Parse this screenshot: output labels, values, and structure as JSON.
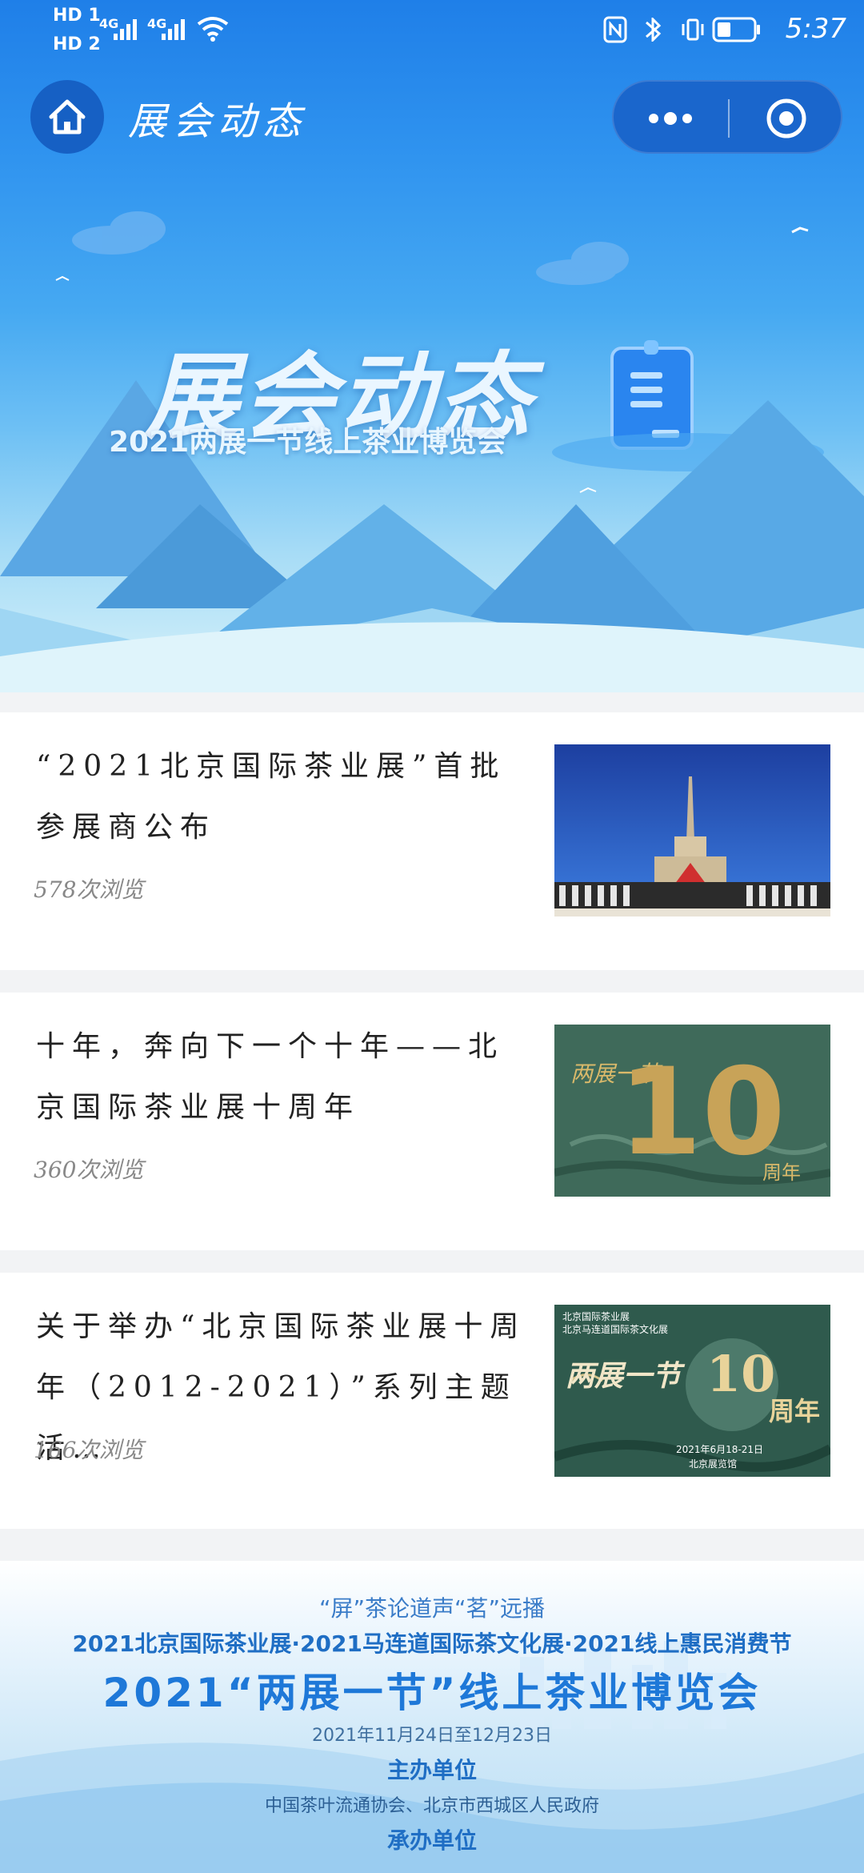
{
  "status_bar": {
    "sim1": "HD 1",
    "sim2": "HD 2",
    "net1": "4G",
    "net2": "4G",
    "time": "5:37"
  },
  "nav": {
    "title": "展会动态"
  },
  "banner": {
    "title": "展会动态",
    "subtitle": "2021两展一节线上茶业博览会"
  },
  "articles": [
    {
      "title": "“2021北京国际茶业展”首批参展商公布",
      "views": "578次浏览"
    },
    {
      "title": "十年，奔向下一个十年——北京国际茶业展十周年",
      "views": "360次浏览",
      "thumb_text": {
        "top": "两展一节",
        "number": "10",
        "suffix": "周年"
      }
    },
    {
      "title": "关于举办“北京国际茶业展十周年（2012-2021）”系列主题活…",
      "views": "166次浏览",
      "thumb_text": {
        "org1": "北京国际茶业展",
        "org2": "北京马连道国际茶文化展",
        "main": "两展一节",
        "number": "10",
        "suffix": "周年",
        "date": "2021年6月18-21日",
        "venue": "北京展览馆"
      }
    }
  ],
  "footer": {
    "slogan": "“屏”茶论道声“茗”远播",
    "events": "2021北京国际茶业展·2021马连道国际茶文化展·2021线上惠民消费节",
    "main_title": "2021“两展一节”线上茶业博览会",
    "dates": "2021年11月24日至12月23日",
    "host_label": "主办单位",
    "host": "中国茶叶流通协会、北京市西城区人民政府",
    "organizer_label": "承办单位"
  }
}
